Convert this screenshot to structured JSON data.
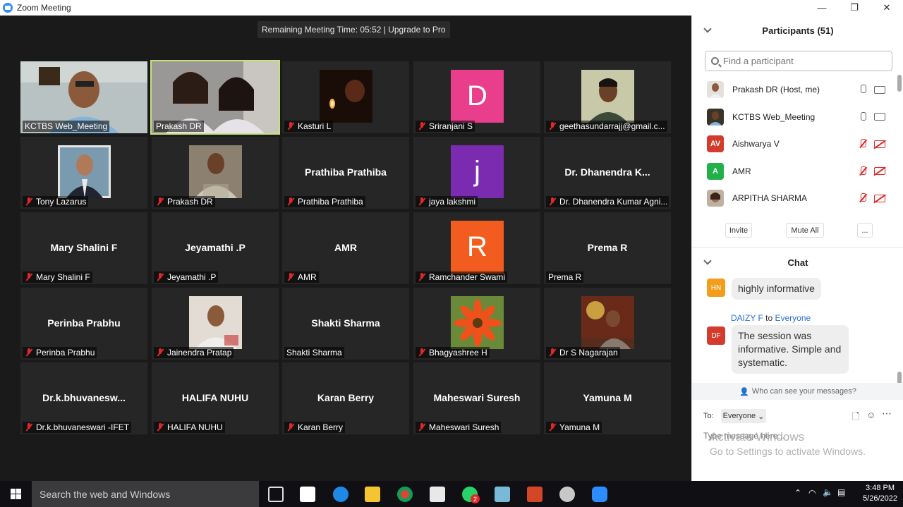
{
  "window": {
    "title": "Zoom Meeting",
    "controls": [
      "—",
      "❐",
      "✕"
    ]
  },
  "banner": {
    "text": "Remaining Meeting Time: 05:52 | Upgrade to Pro"
  },
  "tiles": [
    {
      "label": "KCTBS Web_Meeting",
      "center": "",
      "avatar_letter": "",
      "muted": false
    },
    {
      "label": "Prakash DR",
      "center": "",
      "avatar_letter": "",
      "muted": false
    },
    {
      "label": "Kasturi L",
      "center": "",
      "avatar_letter": "",
      "muted": true
    },
    {
      "label": "Sriranjani S",
      "center": "",
      "avatar_letter": "D",
      "muted": true
    },
    {
      "label": "geethasundarrajj@gmail.c...",
      "center": "",
      "avatar_letter": "",
      "muted": true
    },
    {
      "label": "Tony Lazarus",
      "center": "",
      "avatar_letter": "",
      "muted": true
    },
    {
      "label": "Prakash DR",
      "center": "",
      "avatar_letter": "",
      "muted": true
    },
    {
      "label": "Prathiba Prathiba",
      "center": "Prathiba Prathiba",
      "avatar_letter": "",
      "muted": true
    },
    {
      "label": "jaya lakshmi",
      "center": "",
      "avatar_letter": "j",
      "muted": true
    },
    {
      "label": "Dr. Dhanendra Kumar Agni...",
      "center": "Dr. Dhanendra  K...",
      "avatar_letter": "",
      "muted": true
    },
    {
      "label": "Mary Shalini F",
      "center": "Mary Shalini F",
      "avatar_letter": "",
      "muted": true
    },
    {
      "label": "Jeyamathi .P",
      "center": "Jeyamathi .P",
      "avatar_letter": "",
      "muted": true
    },
    {
      "label": "AMR",
      "center": "AMR",
      "avatar_letter": "",
      "muted": true
    },
    {
      "label": "Ramchander Swami",
      "center": "",
      "avatar_letter": "R",
      "muted": true
    },
    {
      "label": "Prema R",
      "center": "Prema R",
      "avatar_letter": "",
      "muted": false
    },
    {
      "label": "Perinba Prabhu",
      "center": "Perinba Prabhu",
      "avatar_letter": "",
      "muted": true
    },
    {
      "label": "Jainendra Pratap",
      "center": "",
      "avatar_letter": "",
      "muted": true
    },
    {
      "label": "Shakti Sharma",
      "center": "Shakti Sharma",
      "avatar_letter": "",
      "muted": false
    },
    {
      "label": "Bhagyashree H",
      "center": "",
      "avatar_letter": "",
      "muted": true
    },
    {
      "label": "Dr S Nagarajan",
      "center": "",
      "avatar_letter": "",
      "muted": true
    },
    {
      "label": "Dr.k.bhuvaneswari -IFET",
      "center": "Dr.k.bhuvanesw...",
      "avatar_letter": "",
      "muted": true
    },
    {
      "label": "HALIFA NUHU",
      "center": "HALIFA NUHU",
      "avatar_letter": "",
      "muted": true
    },
    {
      "label": "Karan Berry",
      "center": "Karan Berry",
      "avatar_letter": "",
      "muted": true
    },
    {
      "label": "Maheswari Suresh",
      "center": "Maheswari Suresh",
      "avatar_letter": "",
      "muted": true
    },
    {
      "label": "Yamuna M",
      "center": "Yamuna M",
      "avatar_letter": "",
      "muted": true
    }
  ],
  "participants": {
    "title": "Participants (51)",
    "search_placeholder": "Find a participant",
    "list": [
      {
        "name": "Prakash DR (Host, me)",
        "initials": "",
        "color": "#8a7a6a",
        "muted": false
      },
      {
        "name": "KCTBS Web_Meeting",
        "initials": "",
        "color": "#4a4a3a",
        "muted": false
      },
      {
        "name": "Aishwarya V",
        "initials": "AV",
        "color": "#d33b2c",
        "muted": true
      },
      {
        "name": "AMR",
        "initials": "A",
        "color": "#22b04b",
        "muted": true
      },
      {
        "name": "ARPITHA SHARMA",
        "initials": "",
        "color": "#a89080",
        "muted": true
      }
    ],
    "buttons": {
      "invite": "Invite",
      "mute_all": "Mute All",
      "more": "..."
    }
  },
  "chat": {
    "title": "Chat",
    "messages": [
      {
        "initials": "HN",
        "color": "#f29d1b",
        "sender": "",
        "to": "",
        "recipient": "",
        "text": "highly informative"
      },
      {
        "initials": "DF",
        "color": "#d33b2c",
        "sender": "DAIZY F",
        "to": "to",
        "recipient": "Everyone",
        "text": "The session was informative. Simple and systematic."
      }
    ],
    "who_can_see": "Who can see your messages?",
    "to_label": "To:",
    "to_value": "Everyone",
    "input_placeholder": "Type message here..."
  },
  "watermark": {
    "line1": "Activate Windows",
    "line2": "Go to Settings to activate Windows."
  },
  "taskbar": {
    "search_placeholder": "Search the web and Windows",
    "time": "3:48 PM",
    "date": "5/26/2022",
    "whatsapp_badge": "2"
  },
  "colors": {
    "active_speaker": "#c6e27a",
    "avatar_pink": "#e83e8c",
    "avatar_purple": "#7b2bb0",
    "avatar_orange": "#f25c1f",
    "zoom_blue": "#2d8cff"
  }
}
